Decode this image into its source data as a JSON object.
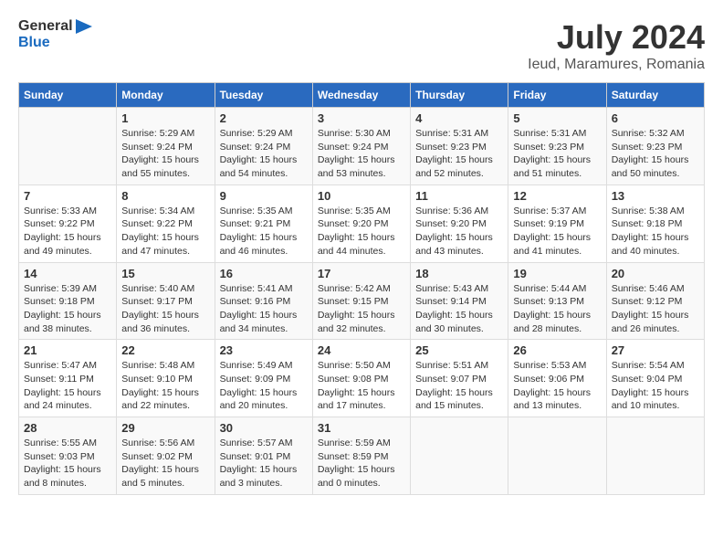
{
  "logo": {
    "line1": "General",
    "line2": "Blue"
  },
  "title": "July 2024",
  "subtitle": "Ieud, Maramures, Romania",
  "weekdays": [
    "Sunday",
    "Monday",
    "Tuesday",
    "Wednesday",
    "Thursday",
    "Friday",
    "Saturday"
  ],
  "weeks": [
    [
      {
        "day": "",
        "info": ""
      },
      {
        "day": "1",
        "info": "Sunrise: 5:29 AM\nSunset: 9:24 PM\nDaylight: 15 hours\nand 55 minutes."
      },
      {
        "day": "2",
        "info": "Sunrise: 5:29 AM\nSunset: 9:24 PM\nDaylight: 15 hours\nand 54 minutes."
      },
      {
        "day": "3",
        "info": "Sunrise: 5:30 AM\nSunset: 9:24 PM\nDaylight: 15 hours\nand 53 minutes."
      },
      {
        "day": "4",
        "info": "Sunrise: 5:31 AM\nSunset: 9:23 PM\nDaylight: 15 hours\nand 52 minutes."
      },
      {
        "day": "5",
        "info": "Sunrise: 5:31 AM\nSunset: 9:23 PM\nDaylight: 15 hours\nand 51 minutes."
      },
      {
        "day": "6",
        "info": "Sunrise: 5:32 AM\nSunset: 9:23 PM\nDaylight: 15 hours\nand 50 minutes."
      }
    ],
    [
      {
        "day": "7",
        "info": "Sunrise: 5:33 AM\nSunset: 9:22 PM\nDaylight: 15 hours\nand 49 minutes."
      },
      {
        "day": "8",
        "info": "Sunrise: 5:34 AM\nSunset: 9:22 PM\nDaylight: 15 hours\nand 47 minutes."
      },
      {
        "day": "9",
        "info": "Sunrise: 5:35 AM\nSunset: 9:21 PM\nDaylight: 15 hours\nand 46 minutes."
      },
      {
        "day": "10",
        "info": "Sunrise: 5:35 AM\nSunset: 9:20 PM\nDaylight: 15 hours\nand 44 minutes."
      },
      {
        "day": "11",
        "info": "Sunrise: 5:36 AM\nSunset: 9:20 PM\nDaylight: 15 hours\nand 43 minutes."
      },
      {
        "day": "12",
        "info": "Sunrise: 5:37 AM\nSunset: 9:19 PM\nDaylight: 15 hours\nand 41 minutes."
      },
      {
        "day": "13",
        "info": "Sunrise: 5:38 AM\nSunset: 9:18 PM\nDaylight: 15 hours\nand 40 minutes."
      }
    ],
    [
      {
        "day": "14",
        "info": "Sunrise: 5:39 AM\nSunset: 9:18 PM\nDaylight: 15 hours\nand 38 minutes."
      },
      {
        "day": "15",
        "info": "Sunrise: 5:40 AM\nSunset: 9:17 PM\nDaylight: 15 hours\nand 36 minutes."
      },
      {
        "day": "16",
        "info": "Sunrise: 5:41 AM\nSunset: 9:16 PM\nDaylight: 15 hours\nand 34 minutes."
      },
      {
        "day": "17",
        "info": "Sunrise: 5:42 AM\nSunset: 9:15 PM\nDaylight: 15 hours\nand 32 minutes."
      },
      {
        "day": "18",
        "info": "Sunrise: 5:43 AM\nSunset: 9:14 PM\nDaylight: 15 hours\nand 30 minutes."
      },
      {
        "day": "19",
        "info": "Sunrise: 5:44 AM\nSunset: 9:13 PM\nDaylight: 15 hours\nand 28 minutes."
      },
      {
        "day": "20",
        "info": "Sunrise: 5:46 AM\nSunset: 9:12 PM\nDaylight: 15 hours\nand 26 minutes."
      }
    ],
    [
      {
        "day": "21",
        "info": "Sunrise: 5:47 AM\nSunset: 9:11 PM\nDaylight: 15 hours\nand 24 minutes."
      },
      {
        "day": "22",
        "info": "Sunrise: 5:48 AM\nSunset: 9:10 PM\nDaylight: 15 hours\nand 22 minutes."
      },
      {
        "day": "23",
        "info": "Sunrise: 5:49 AM\nSunset: 9:09 PM\nDaylight: 15 hours\nand 20 minutes."
      },
      {
        "day": "24",
        "info": "Sunrise: 5:50 AM\nSunset: 9:08 PM\nDaylight: 15 hours\nand 17 minutes."
      },
      {
        "day": "25",
        "info": "Sunrise: 5:51 AM\nSunset: 9:07 PM\nDaylight: 15 hours\nand 15 minutes."
      },
      {
        "day": "26",
        "info": "Sunrise: 5:53 AM\nSunset: 9:06 PM\nDaylight: 15 hours\nand 13 minutes."
      },
      {
        "day": "27",
        "info": "Sunrise: 5:54 AM\nSunset: 9:04 PM\nDaylight: 15 hours\nand 10 minutes."
      }
    ],
    [
      {
        "day": "28",
        "info": "Sunrise: 5:55 AM\nSunset: 9:03 PM\nDaylight: 15 hours\nand 8 minutes."
      },
      {
        "day": "29",
        "info": "Sunrise: 5:56 AM\nSunset: 9:02 PM\nDaylight: 15 hours\nand 5 minutes."
      },
      {
        "day": "30",
        "info": "Sunrise: 5:57 AM\nSunset: 9:01 PM\nDaylight: 15 hours\nand 3 minutes."
      },
      {
        "day": "31",
        "info": "Sunrise: 5:59 AM\nSunset: 8:59 PM\nDaylight: 15 hours\nand 0 minutes."
      },
      {
        "day": "",
        "info": ""
      },
      {
        "day": "",
        "info": ""
      },
      {
        "day": "",
        "info": ""
      }
    ]
  ]
}
